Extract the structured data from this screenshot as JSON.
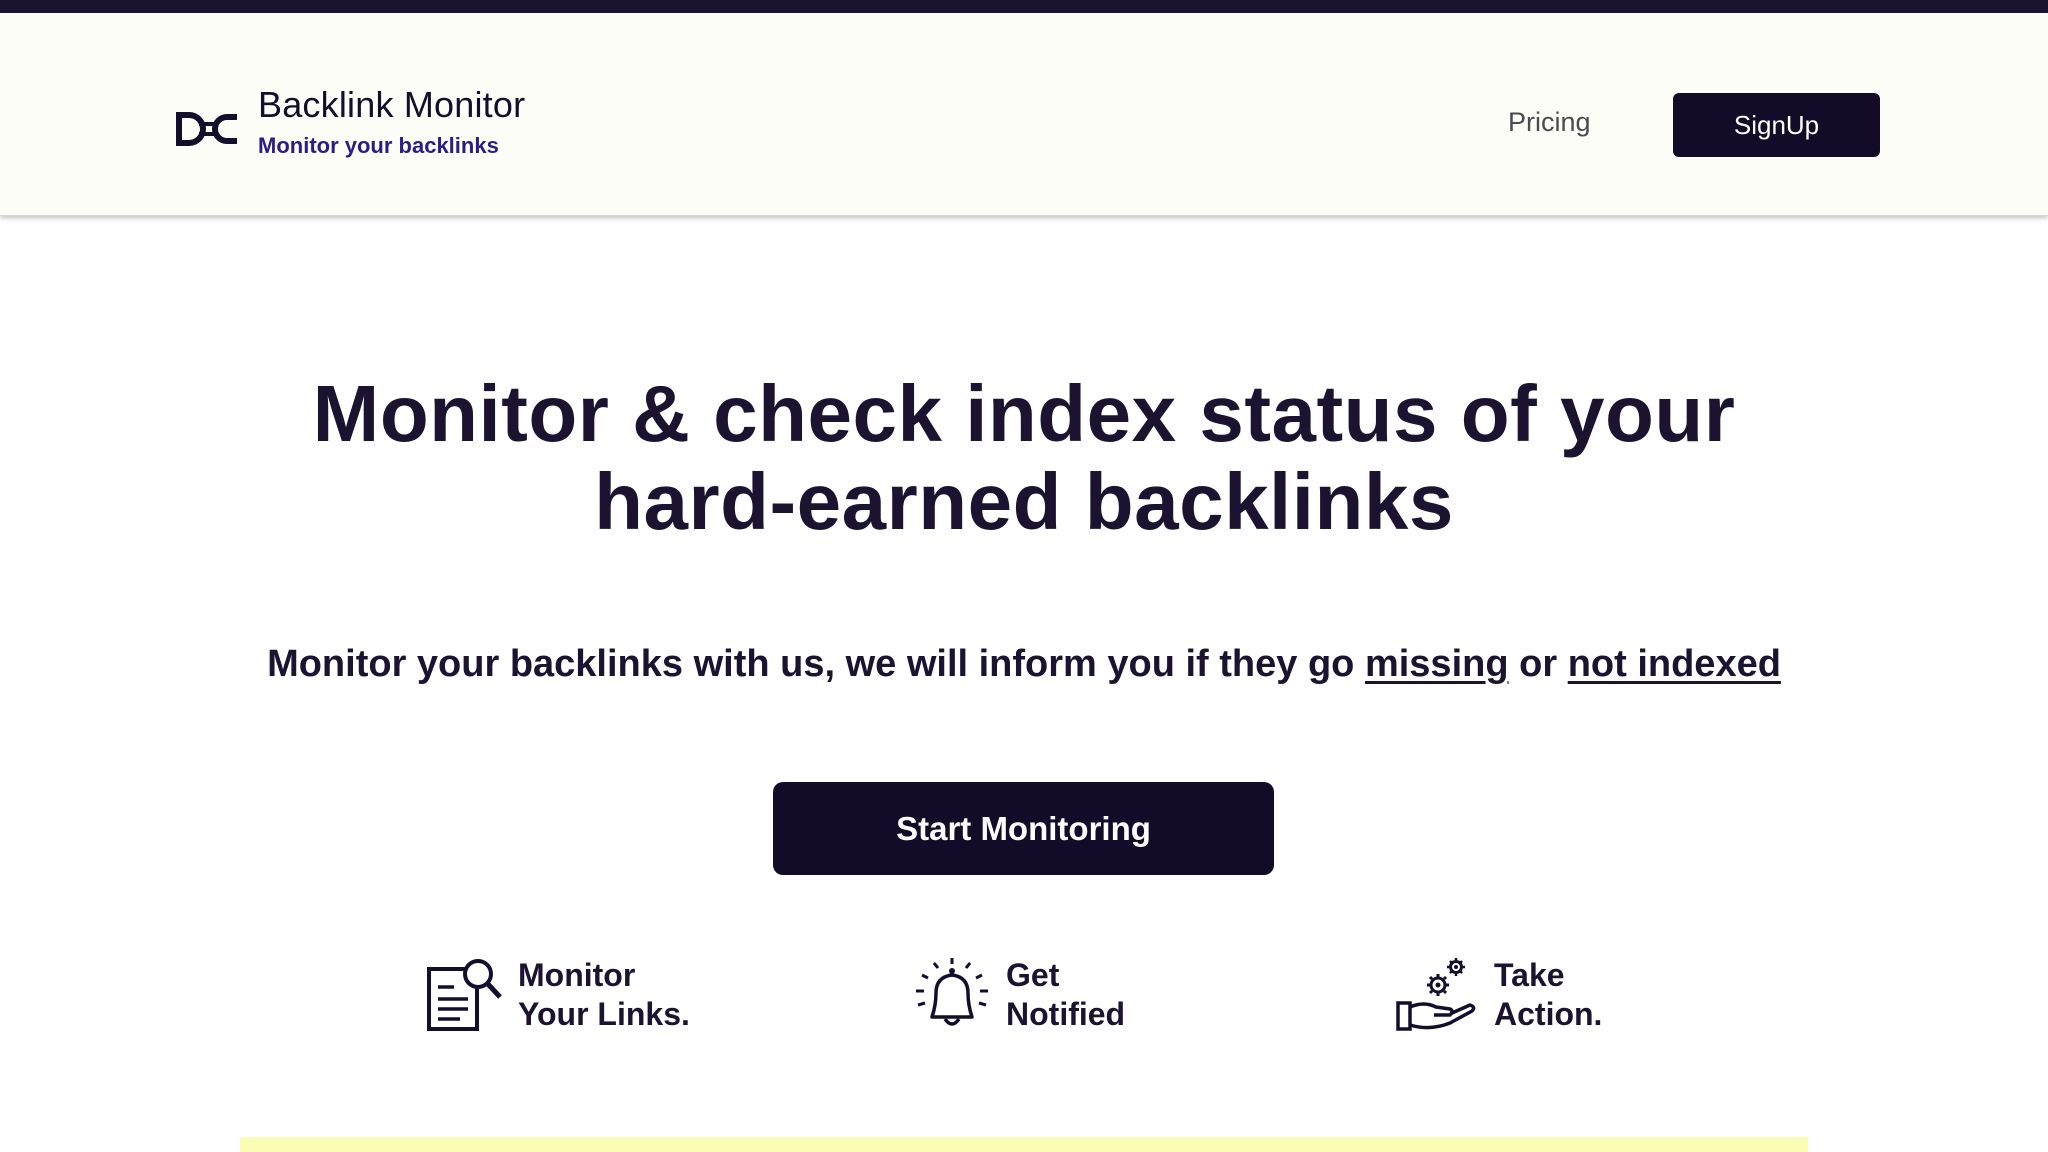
{
  "header": {
    "brand_title": "Backlink Monitor",
    "brand_subtitle": "Monitor your backlinks",
    "nav": {
      "pricing_label": "Pricing",
      "signup_label": "SignUp"
    }
  },
  "hero": {
    "title_line1": "Monitor & check index status of your",
    "title_line2": "hard-earned backlinks",
    "subtitle_prefix": "Monitor your backlinks with us, we will inform you if they go ",
    "subtitle_missing": "missing",
    "subtitle_or": " or ",
    "subtitle_not_indexed": "not indexed",
    "cta_label": "Start Monitoring"
  },
  "features": [
    {
      "icon": "document-search-icon",
      "line1": "Monitor",
      "line2": "Your Links."
    },
    {
      "icon": "bell-icon",
      "line1": "Get",
      "line2": "Notified"
    },
    {
      "icon": "hand-gears-icon",
      "line1": "Take",
      "line2": "Action."
    }
  ],
  "colors": {
    "dark": "#120c28",
    "accent_purple": "#2d1b86",
    "header_bg": "#fcfdf6",
    "band_yellow": "#fbfcb4"
  }
}
